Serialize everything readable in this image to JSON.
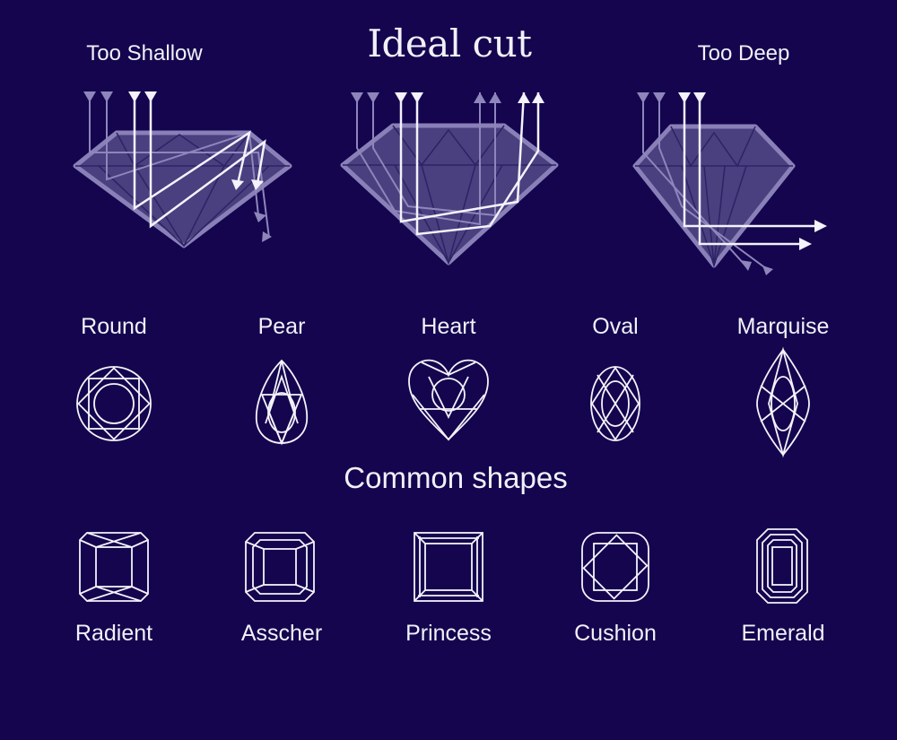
{
  "title": "Ideal cut",
  "cuts": [
    {
      "label": "Too Shallow"
    },
    {
      "label": "Ideal cut"
    },
    {
      "label": "Too Deep"
    }
  ],
  "section_title": "Common shapes",
  "shapes_row1": [
    {
      "label": "Round"
    },
    {
      "label": "Pear"
    },
    {
      "label": "Heart"
    },
    {
      "label": "Oval"
    },
    {
      "label": "Marquise"
    }
  ],
  "shapes_row2": [
    {
      "label": "Radient"
    },
    {
      "label": "Asscher"
    },
    {
      "label": "Princess"
    },
    {
      "label": "Cushion"
    },
    {
      "label": "Emerald"
    }
  ],
  "colors": {
    "background": "#14054e",
    "diamond_fill": "#4a3f7f",
    "diamond_outline": "#8a80b8",
    "ray_bright": "#f4f2fa",
    "ray_faded": "#8e86bb"
  }
}
